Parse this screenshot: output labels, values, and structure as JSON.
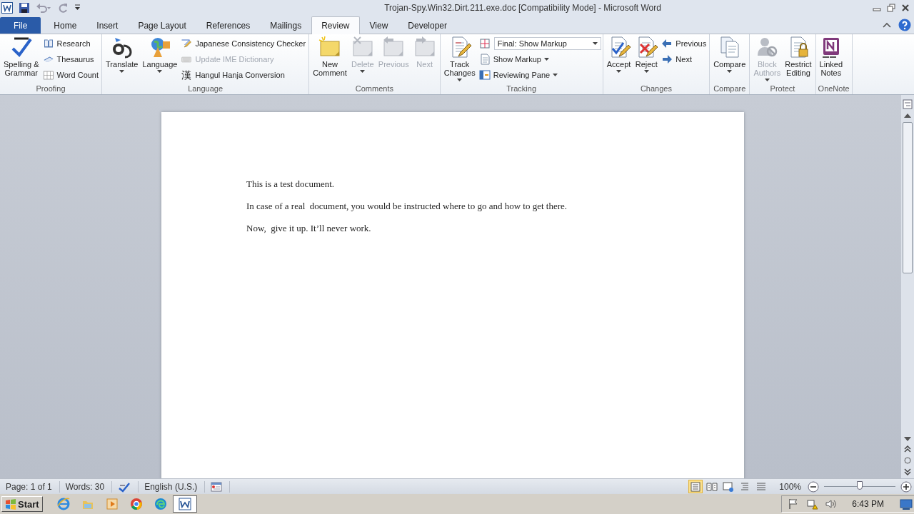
{
  "window": {
    "title": "Trojan-Spy.Win32.Dirt.211.exe.doc [Compatibility Mode]  -  Microsoft Word"
  },
  "tabs": [
    {
      "label": "File",
      "kind": "file",
      "selected": false
    },
    {
      "label": "Home",
      "kind": "tab",
      "selected": false
    },
    {
      "label": "Insert",
      "kind": "tab",
      "selected": false
    },
    {
      "label": "Page Layout",
      "kind": "tab",
      "selected": false
    },
    {
      "label": "References",
      "kind": "tab",
      "selected": false
    },
    {
      "label": "Mailings",
      "kind": "tab",
      "selected": false
    },
    {
      "label": "Review",
      "kind": "tab",
      "selected": true
    },
    {
      "label": "View",
      "kind": "tab",
      "selected": false
    },
    {
      "label": "Developer",
      "kind": "tab",
      "selected": false
    }
  ],
  "ribbon_groups": [
    {
      "label": "Proofing",
      "items": [
        {
          "kind": "large",
          "label": "Spelling &\nGrammar",
          "disabled": false,
          "menu": false
        },
        {
          "kind": "stack",
          "items": [
            {
              "kind": "small",
              "label": "Research",
              "disabled": false,
              "menu": false
            },
            {
              "kind": "small",
              "label": "Thesaurus",
              "disabled": false,
              "menu": false
            },
            {
              "kind": "small",
              "label": "Word Count",
              "disabled": false,
              "menu": false
            }
          ]
        }
      ]
    },
    {
      "label": "Language",
      "items": [
        {
          "kind": "large",
          "label": "Translate",
          "disabled": false,
          "menu": true
        },
        {
          "kind": "large",
          "label": "Language",
          "disabled": false,
          "menu": true
        },
        {
          "kind": "stack",
          "items": [
            {
              "kind": "small",
              "label": "Japanese Consistency Checker",
              "disabled": false,
              "menu": false
            },
            {
              "kind": "small",
              "label": "Update IME Dictionary",
              "disabled": true,
              "menu": false
            },
            {
              "kind": "small",
              "label": "Hangul Hanja Conversion",
              "icon_text": "漢",
              "disabled": false,
              "menu": false
            }
          ]
        }
      ]
    },
    {
      "label": "Comments",
      "items": [
        {
          "kind": "large",
          "label": "New\nComment",
          "disabled": false,
          "menu": false
        },
        {
          "kind": "large",
          "label": "Delete",
          "disabled": true,
          "menu": true
        },
        {
          "kind": "large",
          "label": "Previous",
          "disabled": true,
          "menu": false
        },
        {
          "kind": "large",
          "label": "Next",
          "disabled": true,
          "menu": false
        }
      ]
    },
    {
      "label": "Tracking",
      "items": [
        {
          "kind": "large",
          "label": "Track\nChanges",
          "disabled": false,
          "menu": true
        },
        {
          "kind": "stack",
          "items": [
            {
              "kind": "combo",
              "value": "Final: Show Markup",
              "disabled": false,
              "menu": true
            },
            {
              "kind": "small",
              "label": "Show Markup",
              "disabled": false,
              "menu": true
            },
            {
              "kind": "small",
              "label": "Reviewing Pane",
              "disabled": false,
              "menu": true
            }
          ]
        }
      ]
    },
    {
      "label": "Changes",
      "items": [
        {
          "kind": "large",
          "label": "Accept",
          "disabled": false,
          "menu": true
        },
        {
          "kind": "large",
          "label": "Reject",
          "disabled": false,
          "menu": true
        },
        {
          "kind": "stack",
          "items": [
            {
              "kind": "small",
              "label": "Previous",
              "disabled": false,
              "menu": false
            },
            {
              "kind": "small",
              "label": "Next",
              "disabled": false,
              "menu": false
            }
          ]
        }
      ]
    },
    {
      "label": "Compare",
      "items": [
        {
          "kind": "large",
          "label": "Compare",
          "disabled": false,
          "menu": true
        }
      ]
    },
    {
      "label": "Protect",
      "items": [
        {
          "kind": "large",
          "label": "Block\nAuthors",
          "disabled": true,
          "menu": true
        },
        {
          "kind": "large",
          "label": "Restrict\nEditing",
          "disabled": false,
          "menu": false
        }
      ]
    },
    {
      "label": "OneNote",
      "items": [
        {
          "kind": "large",
          "label": "Linked\nNotes",
          "disabled": false,
          "menu": false
        }
      ]
    }
  ],
  "document": {
    "paragraphs": [
      "This is a test document.",
      "In case of a real  document, you would be instructed where to go and how to get there.",
      "Now,  give it up. It’ll never work."
    ]
  },
  "status_bar": {
    "page": "Page: 1 of 1",
    "words": "Words: 30",
    "language": "English (U.S.)",
    "views": [
      {
        "selected": true
      },
      {
        "selected": false
      },
      {
        "selected": false
      },
      {
        "selected": false
      },
      {
        "selected": false
      }
    ],
    "zoom": "100%",
    "zoom_slider": {
      "level": 0.5
    }
  },
  "taskbar": {
    "start": "Start",
    "apps": [
      {
        "selected": false
      },
      {
        "selected": false
      },
      {
        "selected": false
      },
      {
        "selected": false
      },
      {
        "selected": false
      },
      {
        "selected": true
      }
    ],
    "clock": "6:43 PM"
  }
}
